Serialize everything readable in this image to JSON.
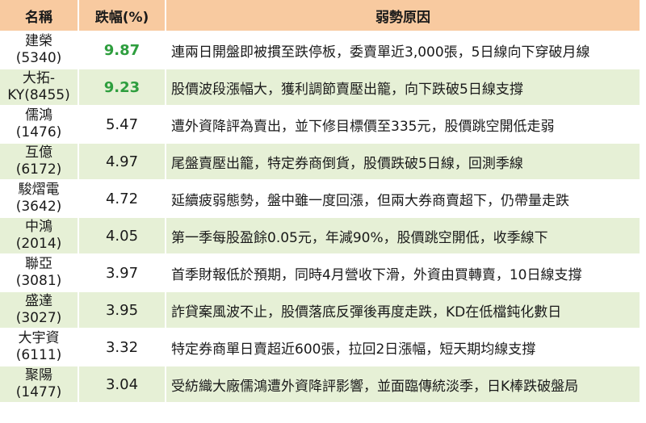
{
  "headers": {
    "name": "名稱",
    "change": "跌幅(%)",
    "reason": "弱勢原因"
  },
  "rows": [
    {
      "name_line1": "建榮",
      "name_line2": "(5340)",
      "change": "9.87",
      "reason": "連兩日開盤即被摜至跌停板，委賣單近3,000張，5日線向下穿破月線"
    },
    {
      "name_line1": "大拓-",
      "name_line2": "KY(8455)",
      "change": "9.23",
      "reason": "股價波段漲幅大，獲利調節賣壓出籠，向下跌破5日線支撐"
    },
    {
      "name_line1": "儒鴻",
      "name_line2": "(1476)",
      "change": "5.47",
      "reason": "遭外資降評為賣出，並下修目標價至335元，股價跳空開低走弱"
    },
    {
      "name_line1": "互億",
      "name_line2": "(6172)",
      "change": "4.97",
      "reason": "尾盤賣壓出籠，特定券商倒貨，股價跌破5日線，回測季線"
    },
    {
      "name_line1": "駿熠電",
      "name_line2": "(3642)",
      "change": "4.72",
      "reason": "延續疲弱態勢，盤中雖一度回漲，但兩大券商賣超下，仍帶量走跌"
    },
    {
      "name_line1": "中鴻",
      "name_line2": "(2014)",
      "change": "4.05",
      "reason": "第一季每股盈餘0.05元，年減90%，股價跳空開低，收季線下"
    },
    {
      "name_line1": "聯亞",
      "name_line2": "(3081)",
      "change": "3.97",
      "reason": "首季財報低於預期，同時4月營收下滑，外資由買轉賣，10日線支撐"
    },
    {
      "name_line1": "盛達",
      "name_line2": "(3027)",
      "change": "3.95",
      "reason": "詐貸案風波不止，股價落底反彈後再度走跌，KD在低檔鈍化數日"
    },
    {
      "name_line1": "大宇資",
      "name_line2": "(6111)",
      "change": "3.32",
      "reason": "特定券商單日賣超近600張，拉回2日漲幅，短天期均線支撐"
    },
    {
      "name_line1": "聚陽",
      "name_line2": "(1477)",
      "change": "3.04",
      "reason": "受紡織大廠儒鴻遭外資降評影響，並面臨傳統淡季，日K棒跌破盤局"
    }
  ],
  "colors": {
    "header_bg": "#f8caa0",
    "band_green": "#e6f0d6",
    "highlight_text": "#2e9e3e"
  }
}
